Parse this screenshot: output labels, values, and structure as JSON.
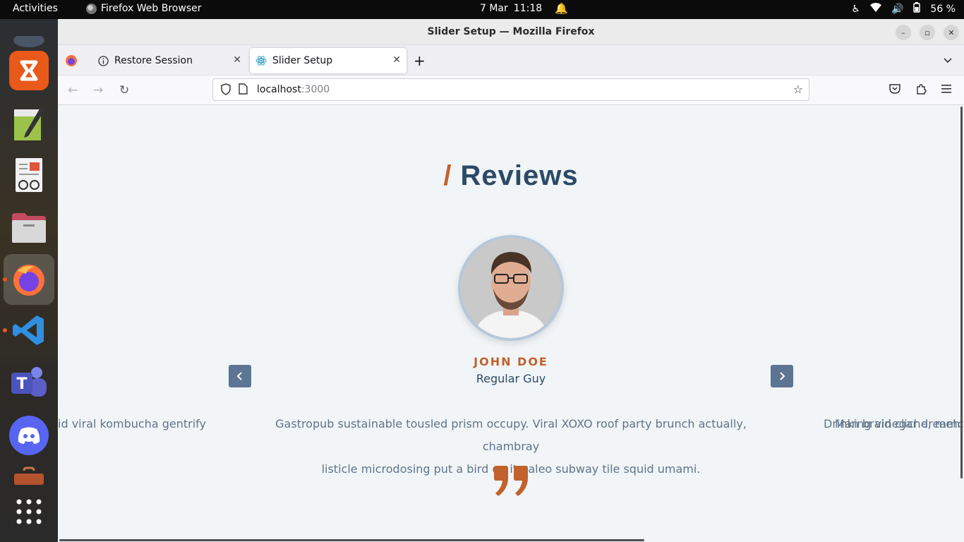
{
  "system": {
    "activities": "Activities",
    "app_name": "Firefox Web Browser",
    "date": "7 Mar",
    "time": "11:18",
    "battery": "56 %"
  },
  "window": {
    "title": "Slider Setup — Mozilla Firefox"
  },
  "tabs": [
    {
      "label": "Restore Session",
      "icon": "info-icon"
    },
    {
      "label": "Slider Setup",
      "icon": "react-icon"
    }
  ],
  "navbar": {
    "url_host": "localhost",
    "url_port": ":3000"
  },
  "page": {
    "heading_slash": "/",
    "heading": "Reviews",
    "name": "JOHN DOE",
    "job": "Regular Guy",
    "quote_line1": "Gastropub sustainable tousled prism occupy. Viral XOXO roof party brunch actually, chambray",
    "quote_line2": "listicle microdosing put a bird on it paleo subway tile squid umami.",
    "left_peek": "id viral kombucha gentrify",
    "right_peek_a": "Drinking vinegar dreamcatcher",
    "right_peek_b": "Man braid cliche, meh woodstock"
  },
  "colors": {
    "accent": "#c2612c",
    "heading": "#2c4a66",
    "arrow_bg": "#5c7593",
    "page_bg": "#f1f5f8"
  }
}
